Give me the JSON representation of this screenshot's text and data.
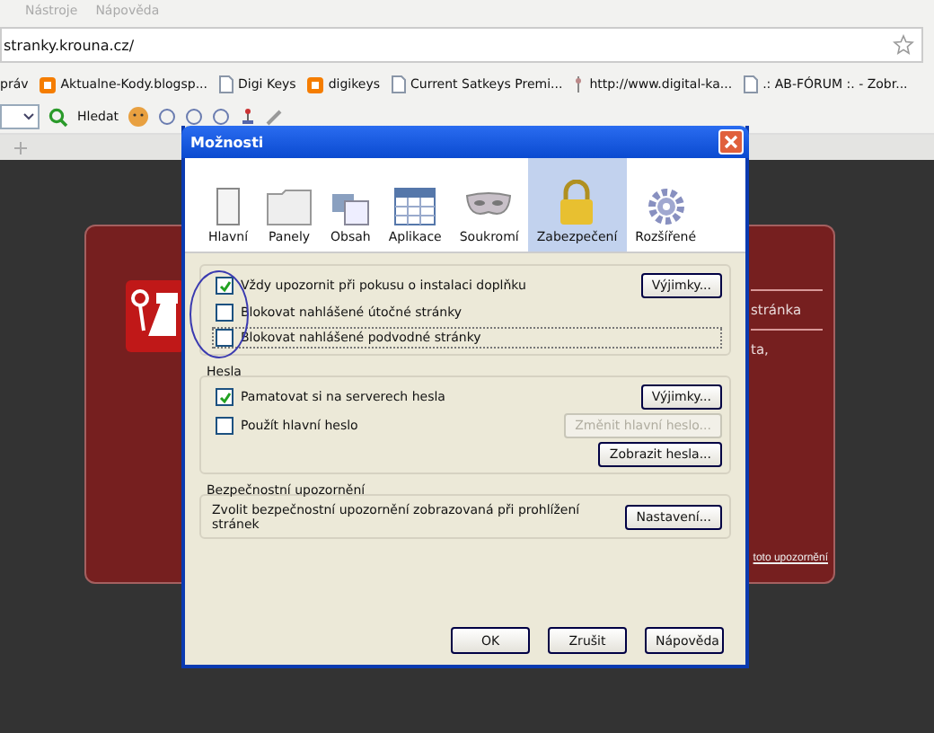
{
  "menu": [
    "Nástroje",
    "Nápověda"
  ],
  "address": "stranky.krouna.cz/",
  "bookmarks": [
    {
      "label": "práv",
      "kind": "none"
    },
    {
      "label": "Aktualne-Kody.blogsp...",
      "kind": "blogger"
    },
    {
      "label": "Digi Keys",
      "kind": "page"
    },
    {
      "label": "digikeys",
      "kind": "blogger"
    },
    {
      "label": "Current Satkeys Premi...",
      "kind": "page"
    },
    {
      "label": "http://www.digital-ka...",
      "kind": "link"
    },
    {
      "label": ".: AB-FÓRUM :. - Zobr...",
      "kind": "page"
    }
  ],
  "toolbar": {
    "search_label": "Hledat"
  },
  "page": {
    "texts": [
      "stránka",
      "ta,"
    ],
    "link": "toto upozornění"
  },
  "dialog": {
    "title": "Možnosti",
    "tabs": [
      {
        "label": "Hlavní",
        "selected": false
      },
      {
        "label": "Panely",
        "selected": false
      },
      {
        "label": "Obsah",
        "selected": false
      },
      {
        "label": "Aplikace",
        "selected": false
      },
      {
        "label": "Soukromí",
        "selected": false
      },
      {
        "label": "Zabezpečení",
        "selected": true
      },
      {
        "label": "Rozšířené",
        "selected": false
      }
    ],
    "groups": [
      {
        "rows": [
          {
            "label": "Vždy upozornit při pokusu o instalaci doplňku",
            "checked": true,
            "focused": false,
            "buttons": [
              {
                "label": "Výjimky...",
                "disabled": false
              }
            ]
          },
          {
            "label": "Blokovat nahlášené útočné stránky",
            "checked": false,
            "focused": false,
            "buttons": []
          },
          {
            "label": "Blokovat nahlášené podvodné stránky",
            "checked": false,
            "focused": true,
            "buttons": []
          }
        ]
      },
      {
        "title": "Hesla",
        "rows": [
          {
            "label": "Pamatovat si na serverech hesla",
            "checked": true,
            "focused": false,
            "buttons": [
              {
                "label": "Výjimky...",
                "disabled": false
              }
            ]
          },
          {
            "label": "Použít hlavní heslo",
            "checked": false,
            "focused": false,
            "buttons": [
              {
                "label": "Změnit hlavní heslo...",
                "disabled": true
              }
            ]
          },
          {
            "buttons": [
              {
                "label": "Zobrazit hesla...",
                "disabled": false
              }
            ]
          }
        ]
      },
      {
        "title": "Bezpečnostní upozornění",
        "rows": [
          {
            "text": "Zvolit bezpečnostní upozornění zobrazovaná při prohlížení stránek",
            "buttons": [
              {
                "label": "Nastavení...",
                "disabled": false
              }
            ]
          }
        ]
      }
    ],
    "buttons": [
      "OK",
      "Zrušit",
      "Nápověda"
    ]
  }
}
